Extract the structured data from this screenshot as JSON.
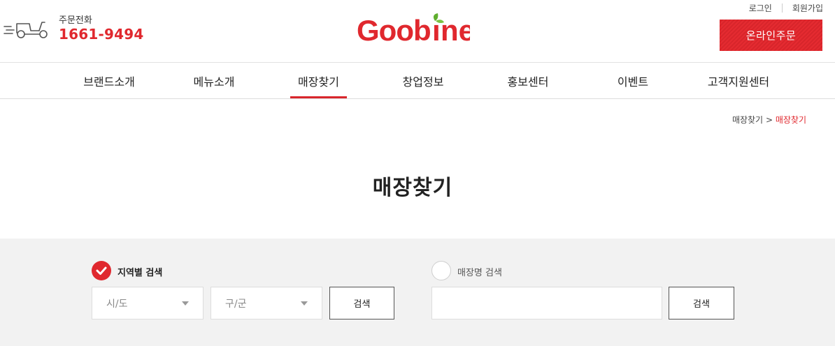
{
  "header": {
    "phone_label": "주문전화",
    "phone_number": "1661-9494",
    "logo_text": "Goobne",
    "login": "로그인",
    "signup": "회원가입",
    "order_button": "온라인주문"
  },
  "nav": {
    "items": [
      {
        "label": "브랜드소개"
      },
      {
        "label": "메뉴소개"
      },
      {
        "label": "매장찾기"
      },
      {
        "label": "창업정보"
      },
      {
        "label": "홍보센터"
      },
      {
        "label": "이벤트"
      },
      {
        "label": "고객지원센터"
      }
    ]
  },
  "breadcrumb": {
    "parent": "매장찾기",
    "separator": ">",
    "current": "매장찾기"
  },
  "page_title": "매장찾기",
  "search": {
    "region": {
      "label": "지역별 검색",
      "selected": true,
      "city_select": "시/도",
      "district_select": "구/군",
      "button": "검색"
    },
    "store": {
      "label": "매장명 검색",
      "selected": false,
      "input_value": "",
      "button": "검색"
    }
  },
  "colors": {
    "brand_red": "#e0282e",
    "search_bg": "#f2f2f2"
  }
}
